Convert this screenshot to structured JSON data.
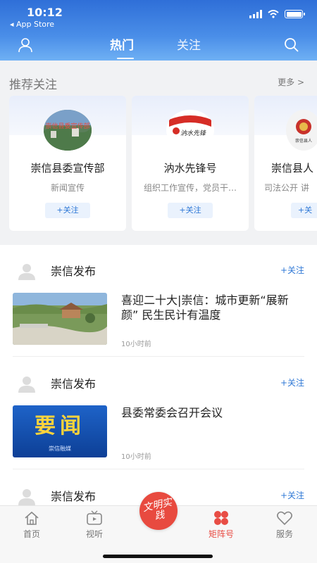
{
  "status_bar": {
    "time": "10:12",
    "back_label": "◂ App Store"
  },
  "header": {
    "tabs": [
      {
        "label": "热门",
        "active": true
      },
      {
        "label": "关注",
        "active": false
      }
    ]
  },
  "recommend": {
    "title": "推荐关注",
    "more_label": "更多 >",
    "cards": [
      {
        "name": "崇信县委宣传部",
        "desc": "新闻宣传",
        "follow_label": "+关注",
        "avatar_text": "崇信县委宣传部"
      },
      {
        "name": "汭水先锋号",
        "desc": "组织工作宣传，党员干…",
        "follow_label": "+关注",
        "avatar_text": "汭水先锋"
      },
      {
        "name": "崇信县人",
        "desc": "司法公开 讲",
        "follow_label": "+关",
        "avatar_text": "崇信县人"
      }
    ]
  },
  "feed": [
    {
      "author": "崇信发布",
      "follow_label": "+关注",
      "title": "喜迎二十大|崇信：城市更新“展新颜” 民生民计有温度",
      "time": "10小时前",
      "thumb": "park-photo"
    },
    {
      "author": "崇信发布",
      "follow_label": "+关注",
      "title": "县委常委会召开会议",
      "time": "10小时前",
      "thumb": "news-banner",
      "thumb_text": "要闻",
      "thumb_sub": "崇信融媒"
    },
    {
      "author": "崇信发布",
      "follow_label": "+关注"
    }
  ],
  "bottom_nav": [
    {
      "label": "首页",
      "icon": "home-icon"
    },
    {
      "label": "视听",
      "icon": "tv-icon"
    },
    {
      "label": "文明实践",
      "icon": "center-badge"
    },
    {
      "label": "矩阵号",
      "icon": "grid-icon",
      "active": true
    },
    {
      "label": "服务",
      "icon": "heart-icon"
    }
  ],
  "colors": {
    "header_blue": "#2f6fd8",
    "accent_red": "#e84d45",
    "follow_blue": "#2f78d6"
  }
}
